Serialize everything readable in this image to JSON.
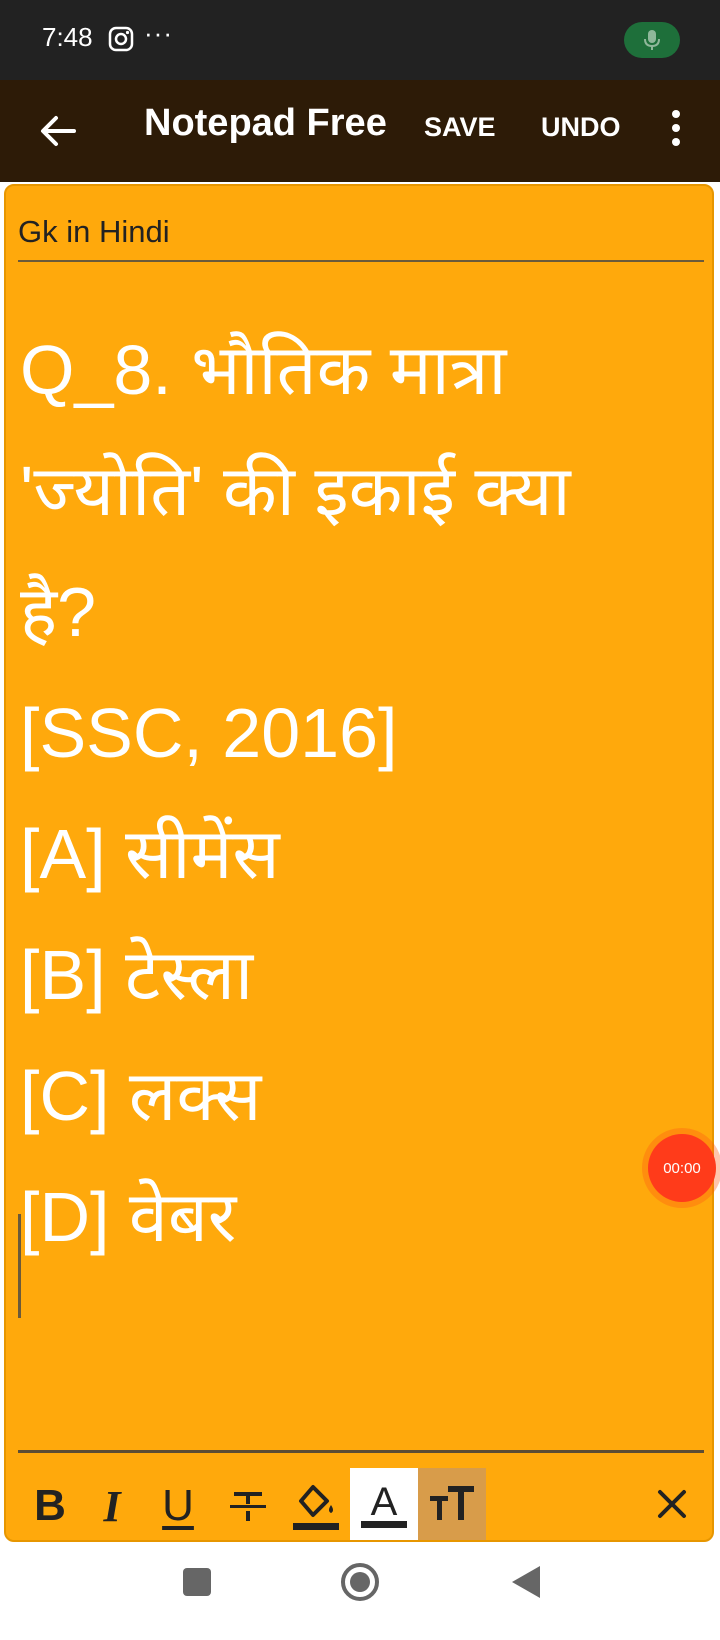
{
  "status_bar": {
    "time": "7:48",
    "more": "···",
    "mic_color": "#1e6f3a"
  },
  "app_bar": {
    "title": "Notepad Free",
    "save_label": "SAVE",
    "undo_label": "UNDO",
    "background": "#2d1b07"
  },
  "note": {
    "title": "Gk in Hindi",
    "background": "#ffa90c",
    "lines": [
      "Q_8. भौतिक मात्रा",
      "'ज्योति' की इकाई क्या",
      "है?",
      "[SSC, 2016]",
      "[A] सीमेंस",
      "[B] टेस्ला",
      "[C] लक्स",
      "[D] वेबर"
    ]
  },
  "recorder": {
    "timer": "00:00"
  },
  "format_toolbar": {
    "bold": "B",
    "italic": "I",
    "underline": "U",
    "text_color": "A",
    "text_size": "тT"
  },
  "icons": [
    "instagram-icon",
    "mic-icon",
    "back-arrow-icon",
    "overflow-menu-icon",
    "strikethrough-icon",
    "fill-color-icon",
    "text-color-icon",
    "text-size-icon",
    "close-icon",
    "recent-apps-icon",
    "home-icon",
    "nav-back-icon"
  ]
}
